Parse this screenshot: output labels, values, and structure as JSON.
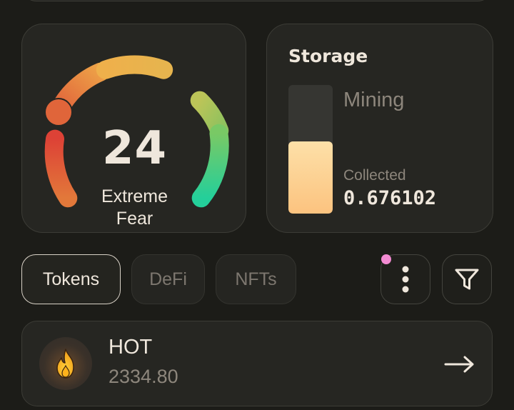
{
  "fear_greed": {
    "value": "24",
    "label_line1": "Extreme",
    "label_line2": "Fear",
    "colors": [
      "#e04a3a",
      "#e6853f",
      "#ebb24c",
      "#a5c35c",
      "#3fcf9b"
    ]
  },
  "storage": {
    "title": "Storage",
    "status": "Mining",
    "collected_label": "Collected",
    "collected_value": "0.676102",
    "fill_fraction": 0.56,
    "fill_color": "#fcc37f"
  },
  "tabs": [
    {
      "label": "Tokens",
      "active": true
    },
    {
      "label": "DeFi",
      "active": false
    },
    {
      "label": "NFTs",
      "active": false
    }
  ],
  "actions": {
    "menu_icon": "more-vertical-icon",
    "filter_icon": "filter-icon",
    "notification_color": "#f28bd2"
  },
  "tokens": [
    {
      "symbol": "HOT",
      "amount": "2334.80",
      "icon": "fire-icon"
    }
  ]
}
